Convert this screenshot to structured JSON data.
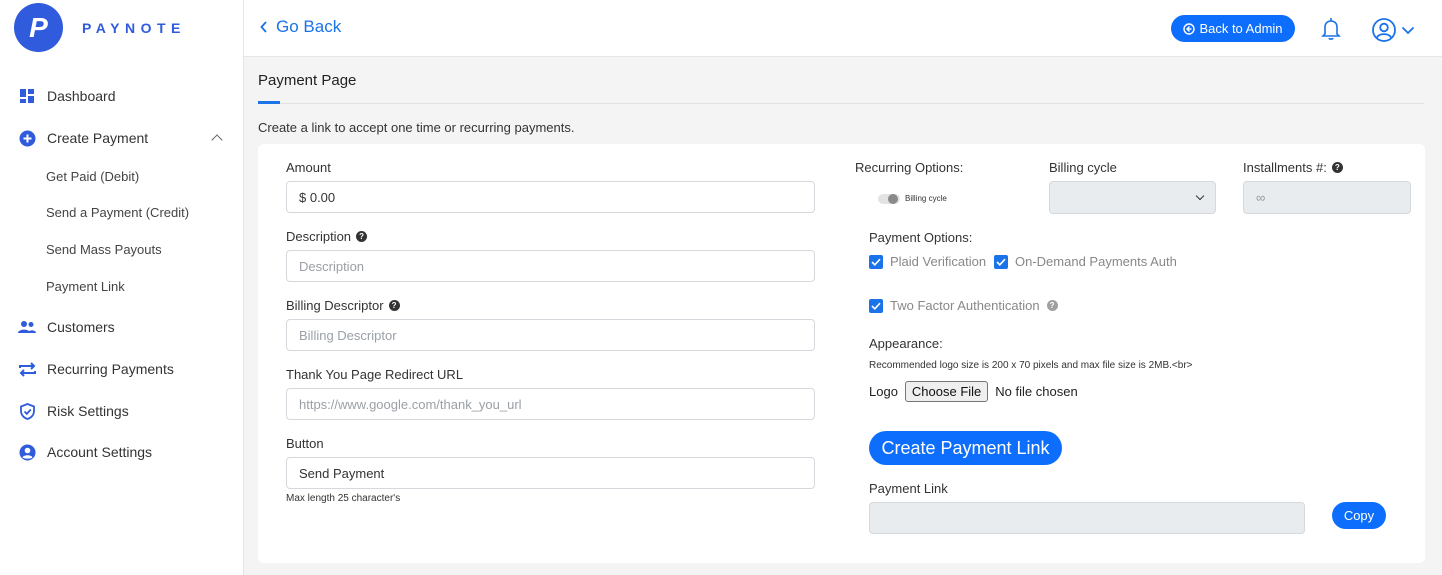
{
  "brand": {
    "name": "PAYNOTE",
    "logo_letter": "P",
    "accent": "#2f5bdc"
  },
  "sidebar": {
    "items": [
      {
        "label": "Dashboard",
        "icon": "dashboard-grid-icon"
      },
      {
        "label": "Create Payment",
        "icon": "plus-circle-icon",
        "expanded": true,
        "children": [
          {
            "label": "Get Paid (Debit)"
          },
          {
            "label": "Send a Payment (Credit)"
          },
          {
            "label": "Send Mass Payouts"
          },
          {
            "label": "Payment Link"
          }
        ]
      },
      {
        "label": "Customers",
        "icon": "users-icon"
      },
      {
        "label": "Recurring Payments",
        "icon": "repeat-arrows-icon"
      },
      {
        "label": "Risk Settings",
        "icon": "shield-check-icon"
      },
      {
        "label": "Account Settings",
        "icon": "user-circle-icon"
      }
    ]
  },
  "topbar": {
    "go_back": "Go Back",
    "back_to_admin": "Back to Admin",
    "primary_color": "#0d6efd"
  },
  "page": {
    "title": "Payment Page",
    "description": "Create a link to accept one time or recurring payments."
  },
  "form": {
    "amount": {
      "label": "Amount",
      "value": "$ 0.00"
    },
    "description": {
      "label": "Description",
      "placeholder": "Description"
    },
    "billing_descriptor": {
      "label": "Billing Descriptor",
      "placeholder": "Billing Descriptor"
    },
    "redirect_url": {
      "label": "Thank You Page Redirect URL",
      "placeholder": "https://www.google.com/thank_you_url"
    },
    "button": {
      "label": "Button",
      "value": "Send Payment",
      "note": "Max length 25 character's"
    },
    "recurring": {
      "label": "Recurring Options:",
      "toggle_label": "Billing cycle",
      "toggle_on": false
    },
    "billing_cycle": {
      "label": "Billing cycle",
      "value": ""
    },
    "installments": {
      "label": "Installments #:",
      "value": "∞"
    },
    "payment_options": {
      "label": "Payment Options:",
      "plaid": {
        "label": "Plaid Verification",
        "checked": true
      },
      "on_demand": {
        "label": "On-Demand Payments Auth",
        "checked": true
      },
      "two_factor": {
        "label": "Two Factor Authentication",
        "checked": true
      }
    },
    "appearance": {
      "label": "Appearance:",
      "note": "Recommended logo size is 200 x 70 pixels and max file size is 2MB.<br>",
      "logo_label": "Logo",
      "choose_file": "Choose File",
      "file_status": "No file chosen"
    },
    "create_button": "Create Payment Link",
    "payment_link": {
      "label": "Payment Link",
      "value": ""
    },
    "copy_button": "Copy"
  }
}
